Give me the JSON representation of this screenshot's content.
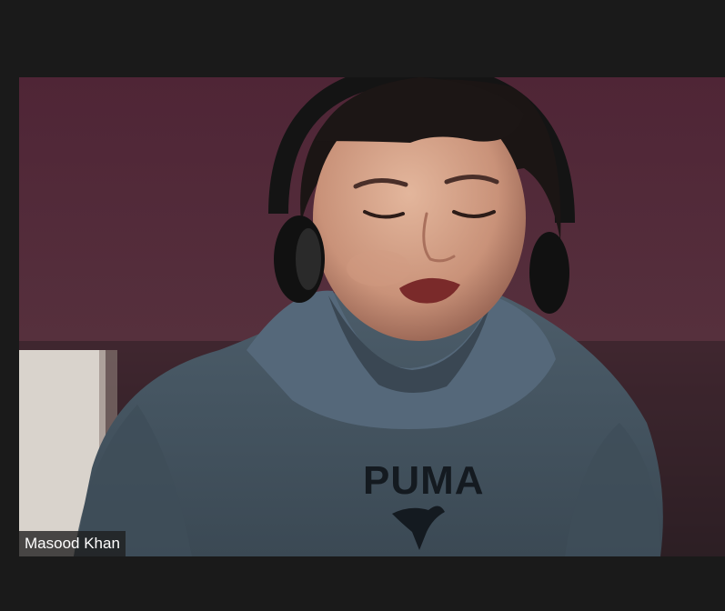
{
  "participant": {
    "name": "Masood Khan"
  },
  "colors": {
    "app_background": "#1a1a1a",
    "label_background": "#1e1e1e",
    "label_text": "#ffffff"
  }
}
